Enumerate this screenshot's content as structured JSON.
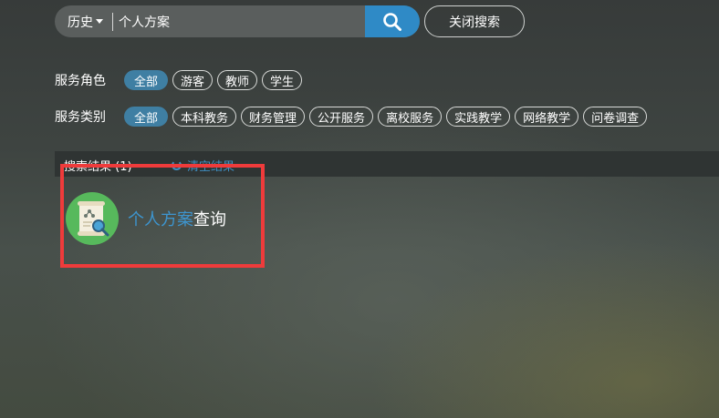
{
  "search": {
    "history_label": "历史",
    "query": "个人方案",
    "close_label": "关闭搜索"
  },
  "filters": {
    "role_label": "服务角色",
    "roles": [
      "全部",
      "游客",
      "教师",
      "学生"
    ],
    "category_label": "服务类别",
    "categories": [
      "全部",
      "本科教务",
      "财务管理",
      "公开服务",
      "离校服务",
      "实践教学",
      "网络教学",
      "问卷调查"
    ]
  },
  "results": {
    "title": "搜索结果 (1)",
    "clear_label": "清空结果",
    "items": [
      {
        "highlight": "个人方案",
        "rest": "查询",
        "icon": "scroll-search-icon"
      }
    ]
  },
  "colors": {
    "accent": "#2f8ac6",
    "chip_active": "#3f7fa3",
    "app_icon_bg": "#57b95c",
    "highlight_text": "#3d95cf",
    "annotation_box": "#ef3b3b"
  }
}
